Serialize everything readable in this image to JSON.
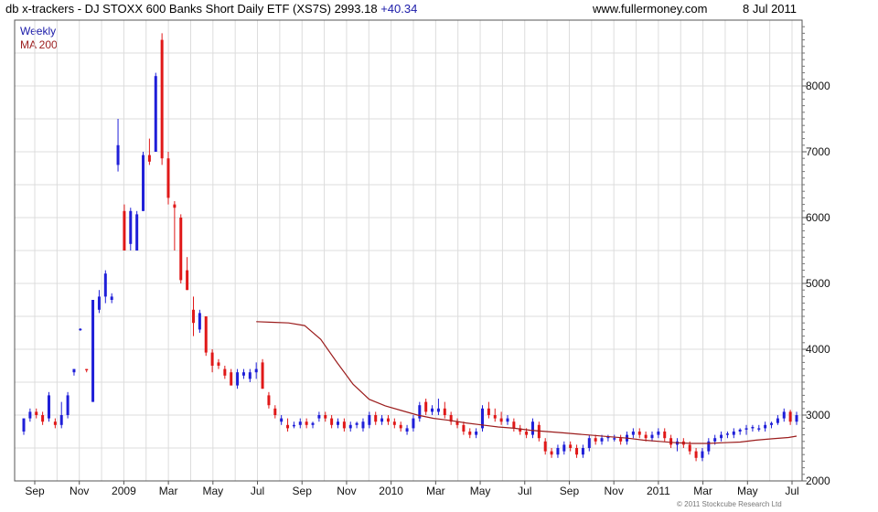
{
  "header": {
    "title": "db x-trackers - DJ STOXX 600 Banks Short Daily ETF (XS7S)",
    "price": "2993.18",
    "change": "+40.34",
    "site": "www.fullermoney.com",
    "date": "8 Jul 2011"
  },
  "legend": {
    "weekly": "Weekly",
    "ma": "MA 200"
  },
  "copyright": "© 2011 Stockcube Research Ltd",
  "colors": {
    "up": "#1f1fd8",
    "down": "#e01818",
    "ma": "#9b1c1c",
    "grid": "#dcdcdc"
  },
  "chart_data": {
    "type": "candlestick",
    "xlabels": [
      "Sep",
      "Nov",
      "2009",
      "Mar",
      "May",
      "Jul",
      "Sep",
      "Nov",
      "2010",
      "Mar",
      "May",
      "Jul",
      "Sep",
      "Nov",
      "2011",
      "Mar",
      "May",
      "Jul"
    ],
    "ylim": [
      2000,
      9000
    ],
    "yticks": [
      2000,
      3000,
      4000,
      5000,
      6000,
      7000,
      8000
    ],
    "candles": [
      [
        2750,
        2950,
        2700,
        2950
      ],
      [
        2950,
        3100,
        2900,
        3050
      ],
      [
        3050,
        3100,
        2950,
        3000
      ],
      [
        3000,
        3050,
        2850,
        2900
      ],
      [
        2950,
        3350,
        2900,
        3300
      ],
      [
        2900,
        2950,
        2800,
        2850
      ],
      [
        2850,
        3200,
        2800,
        3000
      ],
      [
        3000,
        3350,
        2950,
        3300
      ],
      [
        3650,
        3700,
        3600,
        3700
      ],
      [
        4300,
        4320,
        4280,
        4310
      ],
      [
        3700,
        3700,
        3650,
        3680
      ],
      [
        3200,
        4750,
        3200,
        4750
      ],
      [
        4600,
        4900,
        4550,
        4800
      ],
      [
        4800,
        5200,
        4700,
        5150
      ],
      [
        4750,
        4850,
        4700,
        4800
      ],
      [
        6800,
        7500,
        6700,
        7100
      ],
      [
        6100,
        6200,
        5500,
        5500
      ],
      [
        5600,
        6150,
        5500,
        6100
      ],
      [
        5500,
        6100,
        5500,
        6050
      ],
      [
        6100,
        7000,
        6100,
        6950
      ],
      [
        6950,
        7200,
        6800,
        6850
      ],
      [
        7000,
        8200,
        7000,
        8150
      ],
      [
        8700,
        8800,
        6800,
        6900
      ],
      [
        6900,
        7000,
        6200,
        6300
      ],
      [
        6200,
        6250,
        5500,
        6150
      ],
      [
        6000,
        6050,
        5000,
        5050
      ],
      [
        5200,
        5400,
        4900,
        4900
      ],
      [
        4600,
        4800,
        4200,
        4400
      ],
      [
        4300,
        4600,
        4250,
        4550
      ],
      [
        4500,
        4500,
        3900,
        3950
      ],
      [
        3950,
        4000,
        3650,
        3750
      ],
      [
        3800,
        3850,
        3700,
        3750
      ],
      [
        3700,
        3750,
        3550,
        3600
      ],
      [
        3650,
        3700,
        3450,
        3450
      ],
      [
        3450,
        3700,
        3400,
        3650
      ],
      [
        3600,
        3700,
        3550,
        3650
      ],
      [
        3550,
        3700,
        3500,
        3650
      ],
      [
        3650,
        3800,
        3550,
        3700
      ],
      [
        3800,
        3850,
        3400,
        3400
      ],
      [
        3300,
        3350,
        3100,
        3150
      ],
      [
        3100,
        3150,
        2950,
        3000
      ],
      [
        2900,
        3000,
        2850,
        2950
      ],
      [
        2850,
        2950,
        2750,
        2800
      ],
      [
        2850,
        2900,
        2800,
        2850
      ],
      [
        2850,
        2950,
        2800,
        2900
      ],
      [
        2900,
        2950,
        2800,
        2850
      ],
      [
        2850,
        2900,
        2800,
        2880
      ],
      [
        2950,
        3050,
        2900,
        3000
      ],
      [
        3000,
        3050,
        2900,
        2950
      ],
      [
        2950,
        3000,
        2800,
        2850
      ],
      [
        2850,
        2950,
        2800,
        2900
      ],
      [
        2900,
        2950,
        2750,
        2800
      ],
      [
        2800,
        2900,
        2750,
        2850
      ],
      [
        2850,
        2900,
        2800,
        2880
      ],
      [
        2800,
        2950,
        2750,
        2900
      ],
      [
        2850,
        3050,
        2800,
        3000
      ],
      [
        3000,
        3050,
        2850,
        2900
      ],
      [
        2900,
        3000,
        2850,
        2950
      ],
      [
        2950,
        3000,
        2850,
        2900
      ],
      [
        2900,
        2950,
        2800,
        2850
      ],
      [
        2850,
        2900,
        2750,
        2800
      ],
      [
        2750,
        2850,
        2700,
        2800
      ],
      [
        2800,
        3000,
        2750,
        2950
      ],
      [
        2950,
        3200,
        2900,
        3150
      ],
      [
        3200,
        3250,
        3000,
        3050
      ],
      [
        3050,
        3150,
        3000,
        3100
      ],
      [
        3050,
        3250,
        3000,
        3100
      ],
      [
        3100,
        3200,
        2950,
        3000
      ],
      [
        3000,
        3050,
        2850,
        2900
      ],
      [
        2900,
        2950,
        2800,
        2850
      ],
      [
        2850,
        2900,
        2700,
        2750
      ],
      [
        2750,
        2800,
        2650,
        2700
      ],
      [
        2700,
        2800,
        2650,
        2750
      ],
      [
        2800,
        3150,
        2750,
        3100
      ],
      [
        3100,
        3200,
        2950,
        3000
      ],
      [
        3000,
        3100,
        2900,
        2950
      ],
      [
        2950,
        3050,
        2850,
        2900
      ],
      [
        2900,
        3000,
        2850,
        2950
      ],
      [
        2900,
        2950,
        2750,
        2800
      ],
      [
        2800,
        2850,
        2700,
        2750
      ],
      [
        2750,
        2800,
        2650,
        2700
      ],
      [
        2700,
        2950,
        2650,
        2900
      ],
      [
        2850,
        2900,
        2600,
        2650
      ],
      [
        2600,
        2650,
        2400,
        2450
      ],
      [
        2450,
        2500,
        2350,
        2400
      ],
      [
        2400,
        2550,
        2350,
        2500
      ],
      [
        2450,
        2600,
        2400,
        2550
      ],
      [
        2550,
        2600,
        2450,
        2500
      ],
      [
        2500,
        2550,
        2350,
        2400
      ],
      [
        2400,
        2550,
        2350,
        2500
      ],
      [
        2500,
        2700,
        2450,
        2650
      ],
      [
        2650,
        2700,
        2550,
        2600
      ],
      [
        2600,
        2700,
        2550,
        2650
      ],
      [
        2650,
        2700,
        2600,
        2680
      ],
      [
        2650,
        2700,
        2600,
        2650
      ],
      [
        2650,
        2700,
        2550,
        2600
      ],
      [
        2600,
        2750,
        2550,
        2700
      ],
      [
        2700,
        2800,
        2650,
        2750
      ],
      [
        2750,
        2800,
        2650,
        2700
      ],
      [
        2700,
        2750,
        2600,
        2650
      ],
      [
        2650,
        2750,
        2600,
        2700
      ],
      [
        2700,
        2800,
        2650,
        2750
      ],
      [
        2750,
        2800,
        2600,
        2650
      ],
      [
        2650,
        2700,
        2500,
        2550
      ],
      [
        2550,
        2650,
        2450,
        2600
      ],
      [
        2600,
        2650,
        2500,
        2550
      ],
      [
        2550,
        2600,
        2400,
        2450
      ],
      [
        2450,
        2500,
        2300,
        2350
      ],
      [
        2350,
        2500,
        2300,
        2450
      ],
      [
        2450,
        2650,
        2400,
        2600
      ],
      [
        2600,
        2700,
        2550,
        2650
      ],
      [
        2650,
        2750,
        2600,
        2700
      ],
      [
        2700,
        2750,
        2650,
        2720
      ],
      [
        2700,
        2800,
        2650,
        2750
      ],
      [
        2750,
        2800,
        2700,
        2780
      ],
      [
        2780,
        2850,
        2700,
        2800
      ],
      [
        2800,
        2850,
        2750,
        2820
      ],
      [
        2800,
        2850,
        2750,
        2800
      ],
      [
        2800,
        2900,
        2750,
        2850
      ],
      [
        2850,
        2900,
        2800,
        2880
      ],
      [
        2880,
        3000,
        2850,
        2950
      ],
      [
        2950,
        3100,
        2900,
        3050
      ],
      [
        3050,
        3080,
        2850,
        2900
      ],
      [
        2900,
        3050,
        2850,
        3000
      ]
    ],
    "ma200": [
      [
        0,
        4420
      ],
      [
        2,
        4410
      ],
      [
        4,
        4400
      ],
      [
        6,
        4360
      ],
      [
        8,
        4150
      ],
      [
        10,
        3800
      ],
      [
        12,
        3470
      ],
      [
        14,
        3240
      ],
      [
        16,
        3140
      ],
      [
        18,
        3070
      ],
      [
        20,
        3000
      ],
      [
        22,
        2950
      ],
      [
        24,
        2920
      ],
      [
        26,
        2880
      ],
      [
        28,
        2850
      ],
      [
        30,
        2820
      ],
      [
        32,
        2800
      ],
      [
        34,
        2770
      ],
      [
        36,
        2750
      ],
      [
        38,
        2730
      ],
      [
        40,
        2710
      ],
      [
        42,
        2690
      ],
      [
        44,
        2670
      ],
      [
        46,
        2650
      ],
      [
        48,
        2620
      ],
      [
        50,
        2600
      ],
      [
        52,
        2580
      ],
      [
        54,
        2570
      ],
      [
        56,
        2570
      ],
      [
        58,
        2580
      ],
      [
        60,
        2590
      ],
      [
        62,
        2620
      ],
      [
        64,
        2640
      ],
      [
        66,
        2660
      ],
      [
        67,
        2680
      ]
    ]
  }
}
